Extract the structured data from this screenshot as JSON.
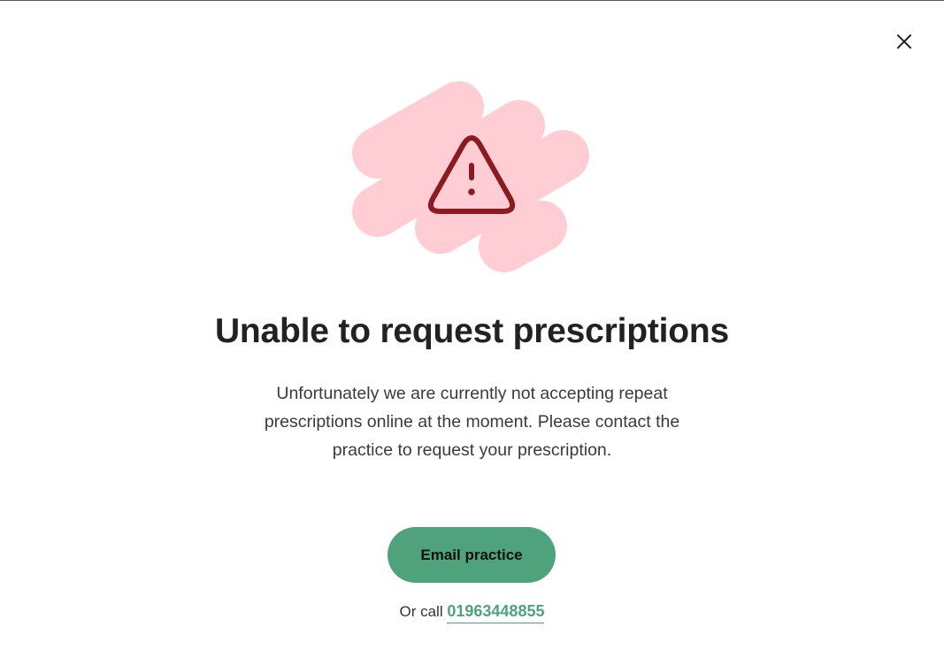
{
  "dialog": {
    "title": "Unable to request prescriptions",
    "description": "Unfortunately we are currently not accepting repeat prescriptions online at the moment. Please contact the practice to request your prescription.",
    "close_icon": "close-icon",
    "hero_icon": "warning-triangle-icon"
  },
  "actions": {
    "email_label": "Email practice",
    "call_prefix": "Or call",
    "phone_number": "01963448855"
  },
  "colors": {
    "accent": "#4fa37c",
    "blob": "#ffcdd3",
    "warning": "#8b1b1f",
    "text": "#222222"
  }
}
